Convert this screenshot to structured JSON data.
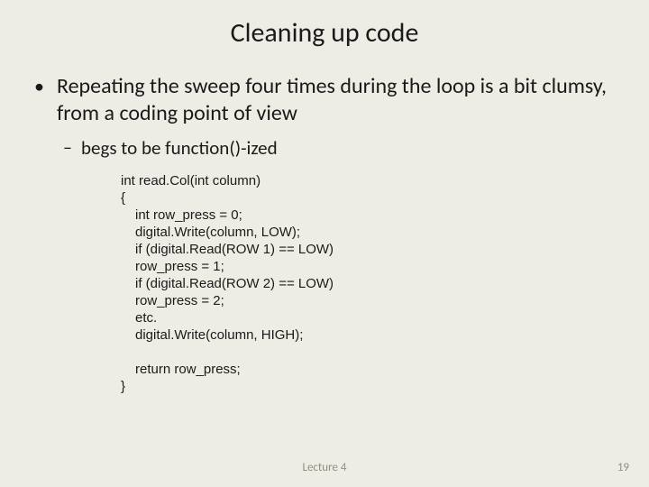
{
  "title": "Cleaning up code",
  "bullet1": "Repeating the sweep four times during the loop is a bit clumsy, from a coding point of view",
  "bullet2": "begs to be function()-ized",
  "code": {
    "l1": "int read.Col(int column)",
    "l2": "{",
    "l3": "int row_press = 0;",
    "l4": "digital.Write(column, LOW);",
    "l5": "if (digital.Read(ROW 1) == LOW)",
    "l6": " row_press = 1;",
    "l7": "if (digital.Read(ROW 2) == LOW)",
    "l8": " row_press = 2;",
    "l9": "etc.",
    "l10": "digital.Write(column, HIGH);",
    "l11": "return row_press;",
    "l12": "}"
  },
  "footer": {
    "lecture": "Lecture 4",
    "page": "19"
  }
}
